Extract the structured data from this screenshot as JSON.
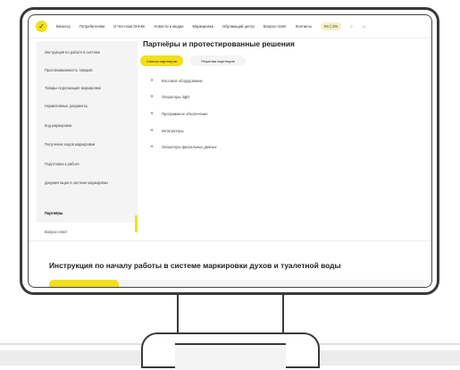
{
  "nav": {
    "items": [
      "Бизнесу",
      "Потребителям",
      "О Честном ЗНАКе",
      "Новости и медиа",
      "Маркировка",
      "Обучающий центр",
      "Вопрос-ответ",
      "Контакты"
    ],
    "lang": "RU | EN",
    "search_icon": "search-icon",
    "user_icon": "user-icon"
  },
  "sidebar": {
    "items": [
      {
        "label": "Инструкция по работе в системе",
        "active": false
      },
      {
        "label": "Прослеживаемость товаров",
        "active": false
      },
      {
        "label": "Товары подлежащие маркировке",
        "active": false
      },
      {
        "label": "Нормативные документы",
        "active": false
      },
      {
        "label": "Код маркировки",
        "active": false
      },
      {
        "label": "Получение кодов маркировки",
        "active": false
      },
      {
        "label": "Подготовка к работе",
        "active": false
      },
      {
        "label": "Документация в системе маркировки",
        "active": false
      },
      {
        "label": "Партнёры",
        "active": true
      },
      {
        "label": "Вопрос-ответ",
        "active": false
      }
    ]
  },
  "main": {
    "title": "Партнёры и протестированные решения",
    "tabs": [
      {
        "label": "Список партнеров",
        "active": true
      },
      {
        "label": "Решения партнеров",
        "active": false
      }
    ],
    "accordion": [
      "Кассовое оборудование",
      "Операторы ЭДО",
      "Программное обеспечение",
      "Интеграторы",
      "Операторы фискальных данных"
    ]
  },
  "bottom": {
    "heading": "Инструкция по началу работы в системе маркировки духов и туалетной воды"
  },
  "colors": {
    "accent": "#f3df1c",
    "sidebar_bg": "#f4f4f4",
    "frame": "#3a3a3a"
  }
}
